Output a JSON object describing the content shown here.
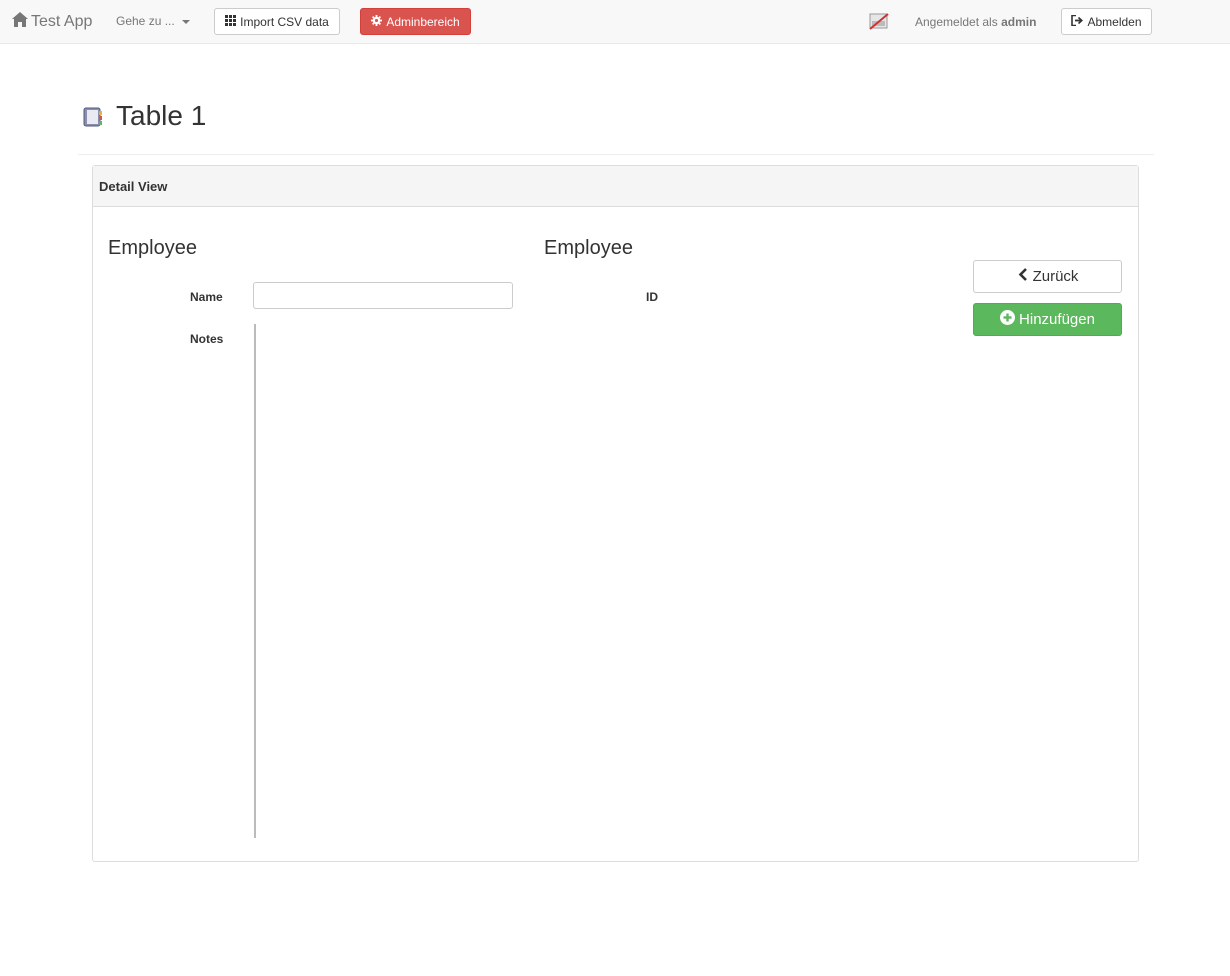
{
  "navbar": {
    "brand": "Test App",
    "goto_label": "Gehe zu ...",
    "import_label": "Import CSV data",
    "admin_label": "Adminbereich",
    "logged_in_prefix": "Angemeldet als",
    "username": "admin",
    "logout_label": "Abmelden"
  },
  "page": {
    "title": "Table 1"
  },
  "panel": {
    "heading": "Detail View",
    "left_section": {
      "title": "Employee",
      "name_label": "Name",
      "name_value": "",
      "notes_label": "Notes",
      "notes_value": ""
    },
    "right_section": {
      "title": "Employee",
      "id_label": "ID"
    },
    "back_label": "Zurück",
    "add_label": "Hinzufügen"
  },
  "colors": {
    "admin_button": "#d9534f",
    "add_button": "#5cb85c",
    "navbar_bg": "#f8f8f8"
  }
}
